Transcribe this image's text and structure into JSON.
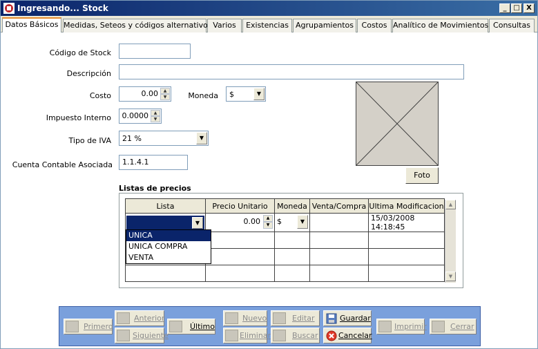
{
  "window": {
    "title": "Ingresando... Stock",
    "controls": {
      "minimize": "_",
      "maximize": "□",
      "close": "X"
    }
  },
  "tabs": [
    {
      "label": "Datos Básicos"
    },
    {
      "label": "Medidas, Seteos y códigos alternativos"
    },
    {
      "label": "Varios"
    },
    {
      "label": "Existencias"
    },
    {
      "label": "Agrupamientos"
    },
    {
      "label": "Costos"
    },
    {
      "label": "Analítico de Movimientos"
    },
    {
      "label": "Consultas"
    }
  ],
  "form": {
    "codigo_label": "Código de Stock",
    "codigo_value": "",
    "descripcion_label": "Descripción",
    "descripcion_value": "",
    "costo_label": "Costo",
    "costo_value": "0.00",
    "moneda_label": "Moneda",
    "moneda_value": "$",
    "impuesto_label": "Impuesto Interno",
    "impuesto_value": "0.0000",
    "iva_label": "Tipo de IVA",
    "iva_value": "21 %",
    "cuenta_label": "Cuenta Contable Asociada",
    "cuenta_value": "1.1.4.1",
    "foto_button": "Foto"
  },
  "price_lists": {
    "title": "Listas de precios",
    "columns": [
      "Lista",
      "Precio Unitario",
      "Moneda",
      "Venta/Compra",
      "Ultima Modificacion"
    ],
    "row": {
      "lista": "",
      "precio": "0.00",
      "moneda": "$",
      "venta_compra": "",
      "ultima_modificacion": "15/03/2008 14:18:45"
    },
    "dropdown_options": [
      "UNICA",
      "UNICA COMPRA",
      "VENTA"
    ],
    "selected_option_index": 0
  },
  "toolbar": {
    "primero": "Primero",
    "anterior": "Anterior",
    "siguiente": "Siguiente",
    "ultimo": "Último",
    "nuevo": "Nuevo",
    "eliminar": "Eliminar",
    "editar": "Editar",
    "buscar": "Buscar",
    "guardar": "Guardar",
    "cancelar": "Cancelar",
    "imprimir": "Imprimir",
    "cerrar": "Cerrar"
  },
  "colors": {
    "titlebar": "#0A246A",
    "toolbar": "#7aa0dc",
    "active_tab_accent": "#e68b2c",
    "selection": "#0A246A"
  }
}
